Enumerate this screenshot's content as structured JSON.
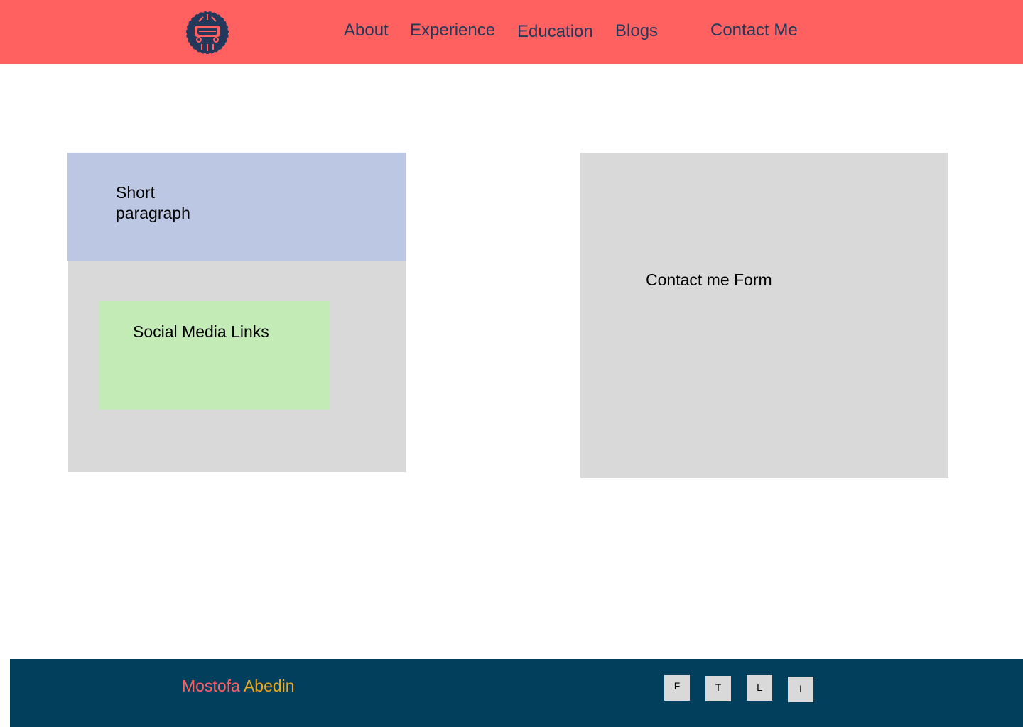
{
  "header": {
    "nav": {
      "about": "About",
      "experience": "Experience",
      "education": "Education",
      "blogs": "Blogs",
      "contact": "Contact Me"
    },
    "logo_icon": "circuit-car-logo-icon"
  },
  "main": {
    "short_paragraph_line1": "Short",
    "short_paragraph_line2": "paragraph",
    "social_media_links": "Social Media Links",
    "contact_form": "Contact me Form"
  },
  "footer": {
    "name_first": "Mostofa",
    "name_last": "Abedin",
    "social": {
      "facebook": "F",
      "twitter": "T",
      "linkedin": "L",
      "instagram": "I"
    }
  },
  "colors": {
    "header_bg": "#ff6161",
    "nav_text": "#23385a",
    "footer_bg": "#013f5c",
    "short_paragraph_bg": "#bbc7e3",
    "social_box_bg": "#c3ebb5",
    "panel_bg": "#d9d9d9",
    "name_first": "#ff6161",
    "name_last": "#f2a71b"
  }
}
